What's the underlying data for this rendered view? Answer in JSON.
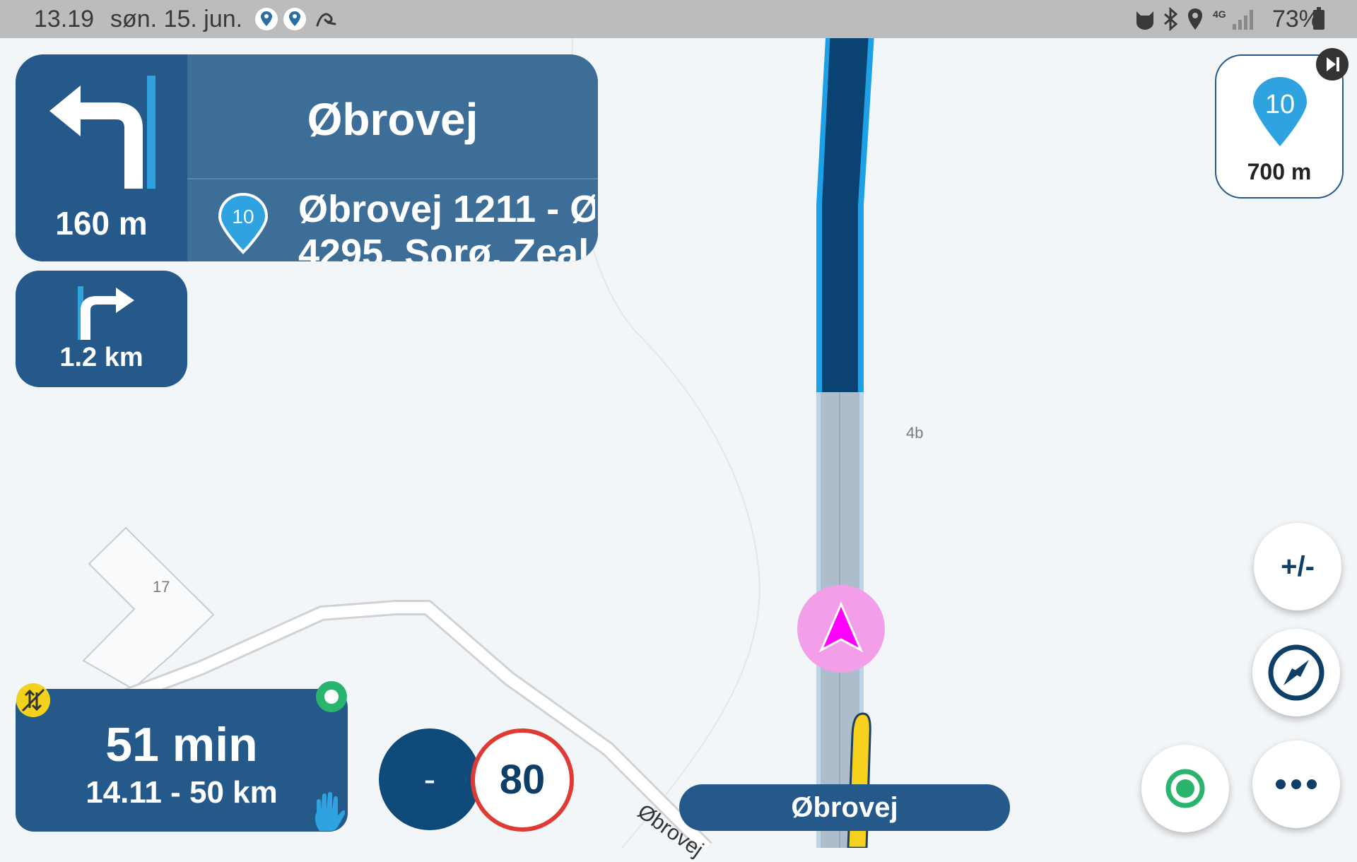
{
  "status_bar": {
    "time": "13.19",
    "date": "søn. 15. jun.",
    "battery": "73%",
    "network": "4G"
  },
  "maneuver": {
    "icon": "turn-left-icon",
    "distance": "160 m",
    "street": "Øbrovej",
    "waypoint_number": "10",
    "address_line1": "Øbrovej 1211 - Ø",
    "address_line2": "4295, Sorø, Zeal"
  },
  "next_maneuver": {
    "icon": "turn-right-icon",
    "distance": "1.2 km"
  },
  "waypoint_card": {
    "number": "10",
    "distance": "700 m"
  },
  "eta": {
    "duration": "51 min",
    "arrival_and_distance": "14.11 - 50 km"
  },
  "speed": {
    "current": "-",
    "limit": "80"
  },
  "current_road": "Øbrovej",
  "map": {
    "labels": {
      "house_4b": "4b",
      "house_17": "17",
      "road_obrovej": "Øbrovej"
    }
  },
  "buttons": {
    "zoom": "+/-"
  },
  "colors": {
    "panel": "#24598a",
    "route_dark": "#0a4272",
    "route_edge": "#1ea0e6",
    "position_marker": "#ff00ff",
    "speed_limit_ring": "#e03a34",
    "waypoint_pin": "#2ea3e0"
  }
}
